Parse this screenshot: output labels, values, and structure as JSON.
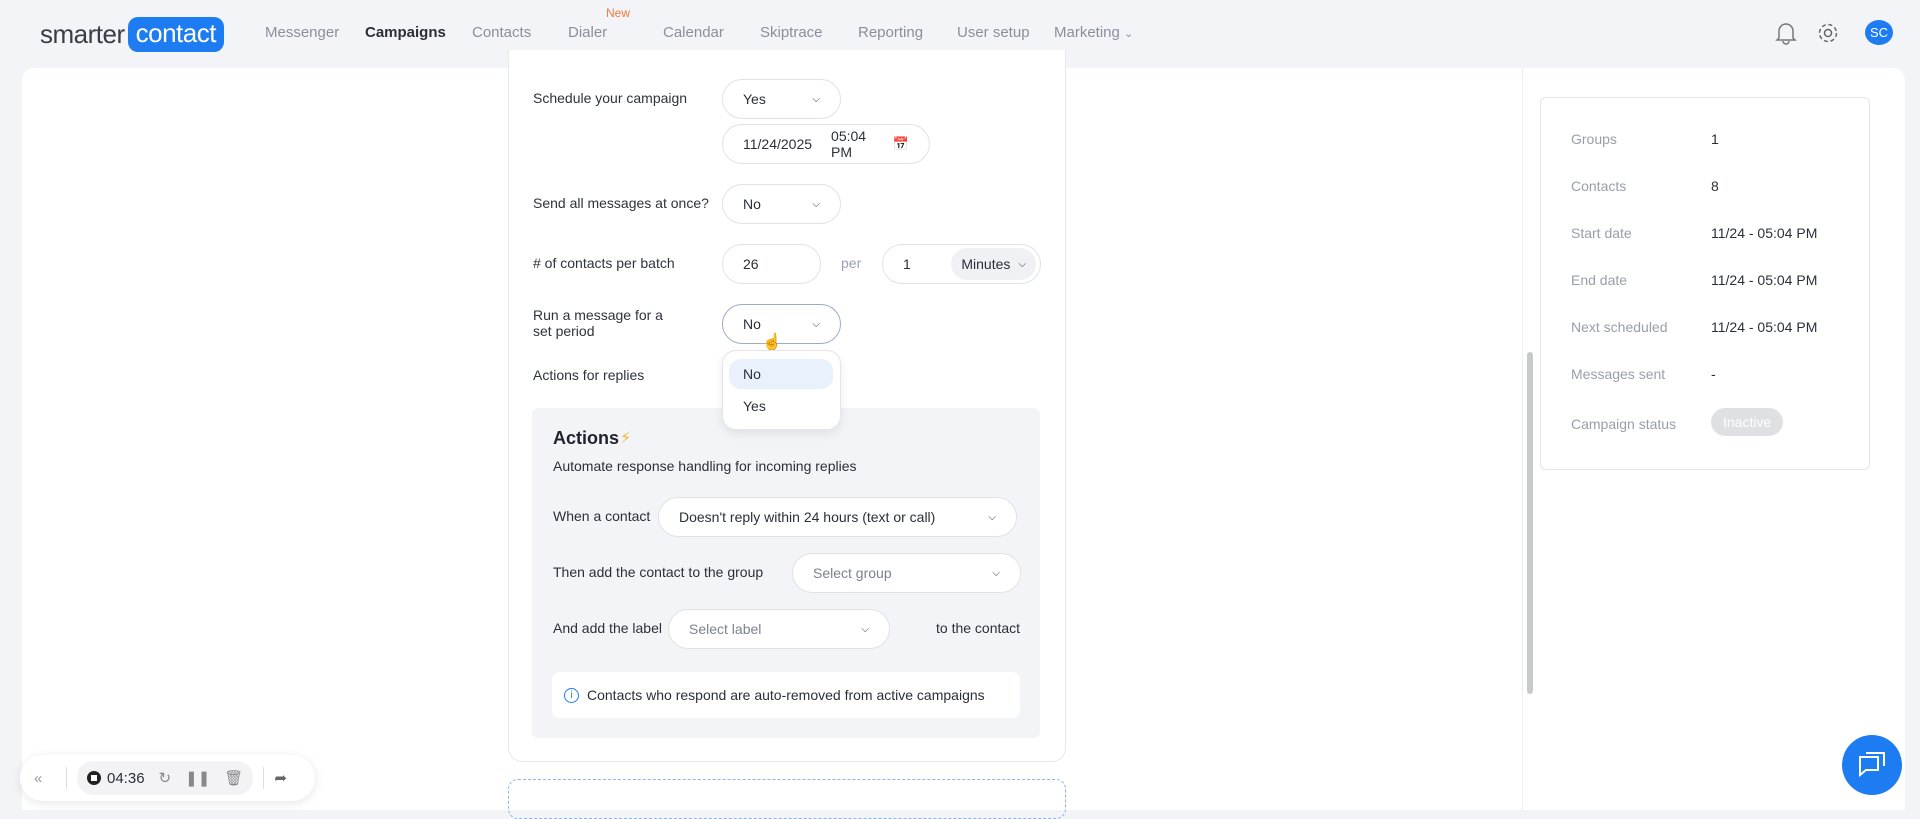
{
  "header": {
    "logo_left": "smarter",
    "logo_right": "contact",
    "nav": [
      {
        "label": "Messenger"
      },
      {
        "label": "Campaigns",
        "active": true
      },
      {
        "label": "Contacts"
      },
      {
        "label": "Dialer",
        "badge": "New"
      },
      {
        "label": "Calendar"
      },
      {
        "label": "Skiptrace"
      },
      {
        "label": "Reporting"
      },
      {
        "label": "User setup"
      },
      {
        "label": "Marketing"
      }
    ],
    "avatar": "SC",
    "accent": "#1d7cf2"
  },
  "form": {
    "schedule_label": "Schedule your campaign",
    "schedule_value": "Yes",
    "date": "11/24/2025",
    "time": "05:04 PM",
    "send_all_label": "Send all messages at once?",
    "send_all_value": "No",
    "batch_label": "# of contacts per batch",
    "batch_value": "26",
    "per": "per",
    "interval_value": "1",
    "interval_unit": "Minutes",
    "run_label": "Run a message for a set period",
    "run_value": "No",
    "run_options": [
      "No",
      "Yes"
    ],
    "replies_label": "Actions for replies"
  },
  "actions": {
    "title": "Actions",
    "subtitle": "Automate response handling for incoming replies",
    "when_label": "When a contact",
    "when_value": "Doesn't reply within 24 hours (text or call)",
    "group_label": "Then add the contact to the group",
    "group_placeholder": "Select group",
    "label_label": "And add the label",
    "label_placeholder": "Select label",
    "label_suffix": "to the contact",
    "info": "Contacts who respond are auto-removed from active campaigns"
  },
  "summary": [
    {
      "k": "Groups",
      "v": "1"
    },
    {
      "k": "Contacts",
      "v": "8"
    },
    {
      "k": "Start date",
      "v": "11/24 - 05:04 PM"
    },
    {
      "k": "End date",
      "v": "11/24 - 05:04 PM"
    },
    {
      "k": "Next scheduled",
      "v": "11/24 - 05:04 PM"
    },
    {
      "k": "Messages sent",
      "v": "-"
    },
    {
      "k": "Campaign status",
      "v": "Inactive"
    }
  ],
  "recorder": {
    "time": "04:36"
  }
}
